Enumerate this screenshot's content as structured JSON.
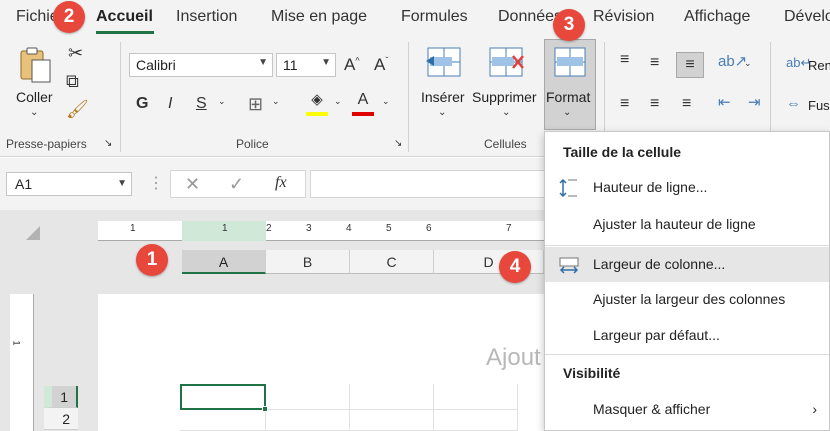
{
  "tabs": [
    "Fichier",
    "Accueil",
    "Insertion",
    "Mise en page",
    "Formules",
    "Données",
    "Révision",
    "Affichage",
    "Dévelo"
  ],
  "clipboard": {
    "paste_label": "Coller",
    "group_label": "Presse-papiers"
  },
  "font": {
    "name": "Calibri",
    "size": "11",
    "group_label": "Police",
    "bold": "G",
    "italic": "I",
    "underline": "S",
    "font_color_letter": "A",
    "grow": "A^",
    "shrink": "Aˇ"
  },
  "cells": {
    "insert_label": "Insérer",
    "delete_label": "Supprimer",
    "format_label": "Format",
    "group_label": "Cellules"
  },
  "wrap": {
    "label1": "Ren",
    "label2": "Fus"
  },
  "formula_bar": {
    "name_box": "A1",
    "fx": "fx"
  },
  "ruler": {
    "numbers": [
      "1",
      "1",
      "2",
      "3",
      "4",
      "5",
      "6",
      "7"
    ]
  },
  "columns": [
    "A",
    "B",
    "C",
    "D"
  ],
  "rows": [
    "1",
    "2"
  ],
  "page_placeholder": "Ajout",
  "badges": [
    "1",
    "2",
    "3",
    "4"
  ],
  "menu": {
    "section1": "Taille de la cellule",
    "items1": [
      "Hauteur de ligne...",
      "Ajuster la hauteur de ligne",
      "Largeur de colonne...",
      "Ajuster la largeur des colonnes",
      "Largeur par défaut..."
    ],
    "section2": "Visibilité",
    "items2": [
      "Masquer & afficher"
    ]
  },
  "colors": {
    "excel_green": "#217346",
    "badge_red": "#e8473c"
  }
}
